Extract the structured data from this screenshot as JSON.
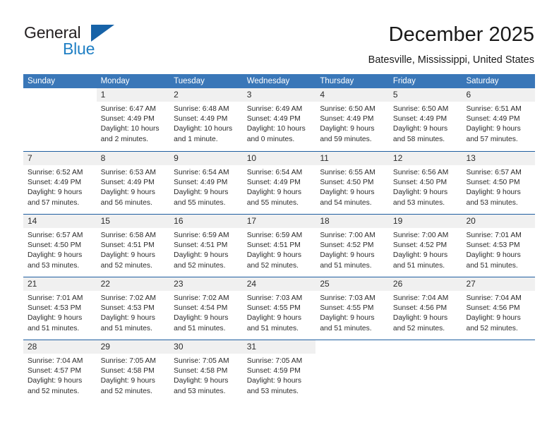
{
  "brand": {
    "general": "General",
    "blue": "Blue",
    "triangle_icon": "triangle-logo-icon"
  },
  "header": {
    "title": "December 2025",
    "location": "Batesville, Mississippi, United States"
  },
  "calendar": {
    "weekday_headers": [
      "Sunday",
      "Monday",
      "Tuesday",
      "Wednesday",
      "Thursday",
      "Friday",
      "Saturday"
    ],
    "colors": {
      "header_blue": "#3a77b8",
      "separator_blue": "#1f5fa0",
      "daynum_band": "#f0f0f0",
      "brand_blue": "#1f7fc4",
      "logo_triangle": "#1763a8",
      "text": "#2b2b2b"
    },
    "weeks": [
      [
        {
          "day": "",
          "sunrise": "",
          "sunset": "",
          "daylight1": "",
          "daylight2": "",
          "blank": true
        },
        {
          "day": "1",
          "sunrise": "Sunrise: 6:47 AM",
          "sunset": "Sunset: 4:49 PM",
          "daylight1": "Daylight: 10 hours",
          "daylight2": "and 2 minutes."
        },
        {
          "day": "2",
          "sunrise": "Sunrise: 6:48 AM",
          "sunset": "Sunset: 4:49 PM",
          "daylight1": "Daylight: 10 hours",
          "daylight2": "and 1 minute."
        },
        {
          "day": "3",
          "sunrise": "Sunrise: 6:49 AM",
          "sunset": "Sunset: 4:49 PM",
          "daylight1": "Daylight: 10 hours",
          "daylight2": "and 0 minutes."
        },
        {
          "day": "4",
          "sunrise": "Sunrise: 6:50 AM",
          "sunset": "Sunset: 4:49 PM",
          "daylight1": "Daylight: 9 hours",
          "daylight2": "and 59 minutes."
        },
        {
          "day": "5",
          "sunrise": "Sunrise: 6:50 AM",
          "sunset": "Sunset: 4:49 PM",
          "daylight1": "Daylight: 9 hours",
          "daylight2": "and 58 minutes."
        },
        {
          "day": "6",
          "sunrise": "Sunrise: 6:51 AM",
          "sunset": "Sunset: 4:49 PM",
          "daylight1": "Daylight: 9 hours",
          "daylight2": "and 57 minutes."
        }
      ],
      [
        {
          "day": "7",
          "sunrise": "Sunrise: 6:52 AM",
          "sunset": "Sunset: 4:49 PM",
          "daylight1": "Daylight: 9 hours",
          "daylight2": "and 57 minutes."
        },
        {
          "day": "8",
          "sunrise": "Sunrise: 6:53 AM",
          "sunset": "Sunset: 4:49 PM",
          "daylight1": "Daylight: 9 hours",
          "daylight2": "and 56 minutes."
        },
        {
          "day": "9",
          "sunrise": "Sunrise: 6:54 AM",
          "sunset": "Sunset: 4:49 PM",
          "daylight1": "Daylight: 9 hours",
          "daylight2": "and 55 minutes."
        },
        {
          "day": "10",
          "sunrise": "Sunrise: 6:54 AM",
          "sunset": "Sunset: 4:49 PM",
          "daylight1": "Daylight: 9 hours",
          "daylight2": "and 55 minutes."
        },
        {
          "day": "11",
          "sunrise": "Sunrise: 6:55 AM",
          "sunset": "Sunset: 4:50 PM",
          "daylight1": "Daylight: 9 hours",
          "daylight2": "and 54 minutes."
        },
        {
          "day": "12",
          "sunrise": "Sunrise: 6:56 AM",
          "sunset": "Sunset: 4:50 PM",
          "daylight1": "Daylight: 9 hours",
          "daylight2": "and 53 minutes."
        },
        {
          "day": "13",
          "sunrise": "Sunrise: 6:57 AM",
          "sunset": "Sunset: 4:50 PM",
          "daylight1": "Daylight: 9 hours",
          "daylight2": "and 53 minutes."
        }
      ],
      [
        {
          "day": "14",
          "sunrise": "Sunrise: 6:57 AM",
          "sunset": "Sunset: 4:50 PM",
          "daylight1": "Daylight: 9 hours",
          "daylight2": "and 53 minutes."
        },
        {
          "day": "15",
          "sunrise": "Sunrise: 6:58 AM",
          "sunset": "Sunset: 4:51 PM",
          "daylight1": "Daylight: 9 hours",
          "daylight2": "and 52 minutes."
        },
        {
          "day": "16",
          "sunrise": "Sunrise: 6:59 AM",
          "sunset": "Sunset: 4:51 PM",
          "daylight1": "Daylight: 9 hours",
          "daylight2": "and 52 minutes."
        },
        {
          "day": "17",
          "sunrise": "Sunrise: 6:59 AM",
          "sunset": "Sunset: 4:51 PM",
          "daylight1": "Daylight: 9 hours",
          "daylight2": "and 52 minutes."
        },
        {
          "day": "18",
          "sunrise": "Sunrise: 7:00 AM",
          "sunset": "Sunset: 4:52 PM",
          "daylight1": "Daylight: 9 hours",
          "daylight2": "and 51 minutes."
        },
        {
          "day": "19",
          "sunrise": "Sunrise: 7:00 AM",
          "sunset": "Sunset: 4:52 PM",
          "daylight1": "Daylight: 9 hours",
          "daylight2": "and 51 minutes."
        },
        {
          "day": "20",
          "sunrise": "Sunrise: 7:01 AM",
          "sunset": "Sunset: 4:53 PM",
          "daylight1": "Daylight: 9 hours",
          "daylight2": "and 51 minutes."
        }
      ],
      [
        {
          "day": "21",
          "sunrise": "Sunrise: 7:01 AM",
          "sunset": "Sunset: 4:53 PM",
          "daylight1": "Daylight: 9 hours",
          "daylight2": "and 51 minutes."
        },
        {
          "day": "22",
          "sunrise": "Sunrise: 7:02 AM",
          "sunset": "Sunset: 4:53 PM",
          "daylight1": "Daylight: 9 hours",
          "daylight2": "and 51 minutes."
        },
        {
          "day": "23",
          "sunrise": "Sunrise: 7:02 AM",
          "sunset": "Sunset: 4:54 PM",
          "daylight1": "Daylight: 9 hours",
          "daylight2": "and 51 minutes."
        },
        {
          "day": "24",
          "sunrise": "Sunrise: 7:03 AM",
          "sunset": "Sunset: 4:55 PM",
          "daylight1": "Daylight: 9 hours",
          "daylight2": "and 51 minutes."
        },
        {
          "day": "25",
          "sunrise": "Sunrise: 7:03 AM",
          "sunset": "Sunset: 4:55 PM",
          "daylight1": "Daylight: 9 hours",
          "daylight2": "and 51 minutes."
        },
        {
          "day": "26",
          "sunrise": "Sunrise: 7:04 AM",
          "sunset": "Sunset: 4:56 PM",
          "daylight1": "Daylight: 9 hours",
          "daylight2": "and 52 minutes."
        },
        {
          "day": "27",
          "sunrise": "Sunrise: 7:04 AM",
          "sunset": "Sunset: 4:56 PM",
          "daylight1": "Daylight: 9 hours",
          "daylight2": "and 52 minutes."
        }
      ],
      [
        {
          "day": "28",
          "sunrise": "Sunrise: 7:04 AM",
          "sunset": "Sunset: 4:57 PM",
          "daylight1": "Daylight: 9 hours",
          "daylight2": "and 52 minutes."
        },
        {
          "day": "29",
          "sunrise": "Sunrise: 7:05 AM",
          "sunset": "Sunset: 4:58 PM",
          "daylight1": "Daylight: 9 hours",
          "daylight2": "and 52 minutes."
        },
        {
          "day": "30",
          "sunrise": "Sunrise: 7:05 AM",
          "sunset": "Sunset: 4:58 PM",
          "daylight1": "Daylight: 9 hours",
          "daylight2": "and 53 minutes."
        },
        {
          "day": "31",
          "sunrise": "Sunrise: 7:05 AM",
          "sunset": "Sunset: 4:59 PM",
          "daylight1": "Daylight: 9 hours",
          "daylight2": "and 53 minutes."
        },
        {
          "day": "",
          "sunrise": "",
          "sunset": "",
          "daylight1": "",
          "daylight2": "",
          "blank": true
        },
        {
          "day": "",
          "sunrise": "",
          "sunset": "",
          "daylight1": "",
          "daylight2": "",
          "blank": true
        },
        {
          "day": "",
          "sunrise": "",
          "sunset": "",
          "daylight1": "",
          "daylight2": "",
          "blank": true
        }
      ]
    ]
  }
}
